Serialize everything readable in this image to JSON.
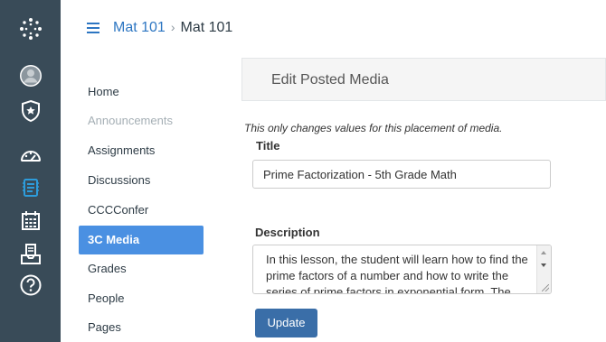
{
  "global_nav": {
    "items": [
      {
        "name": "logo-icon"
      },
      {
        "name": "account-icon"
      },
      {
        "name": "admin-icon"
      },
      {
        "name": "dashboard-icon"
      },
      {
        "name": "courses-icon"
      },
      {
        "name": "calendar-icon"
      },
      {
        "name": "inbox-icon"
      },
      {
        "name": "help-icon"
      }
    ]
  },
  "header": {
    "crumb_link": "Mat 101",
    "separator": "›",
    "crumb_current": "Mat 101"
  },
  "course_nav": {
    "items": [
      {
        "label": "Home"
      },
      {
        "label": "Announcements",
        "disabled": true
      },
      {
        "label": "Assignments"
      },
      {
        "label": "Discussions"
      },
      {
        "label": "CCCConfer"
      },
      {
        "label": "3C Media",
        "active": true
      },
      {
        "label": "Grades"
      },
      {
        "label": "People"
      },
      {
        "label": "Pages"
      }
    ]
  },
  "content": {
    "panel_title": "Edit Posted Media",
    "note": "This only changes values for this placement of media.",
    "title_label": "Title",
    "title_value": "Prime Factorization - 5th Grade Math",
    "description_label": "Description",
    "description_value": "In this lesson, the student will learn how to find the prime factors of a number and how to write the series of prime factors in exponential form. The student",
    "update_label": "Update"
  },
  "colors": {
    "rail": "#394B58",
    "link": "#2D76C2",
    "active_nav": "#4A90E2",
    "button": "#3A6EA8"
  }
}
